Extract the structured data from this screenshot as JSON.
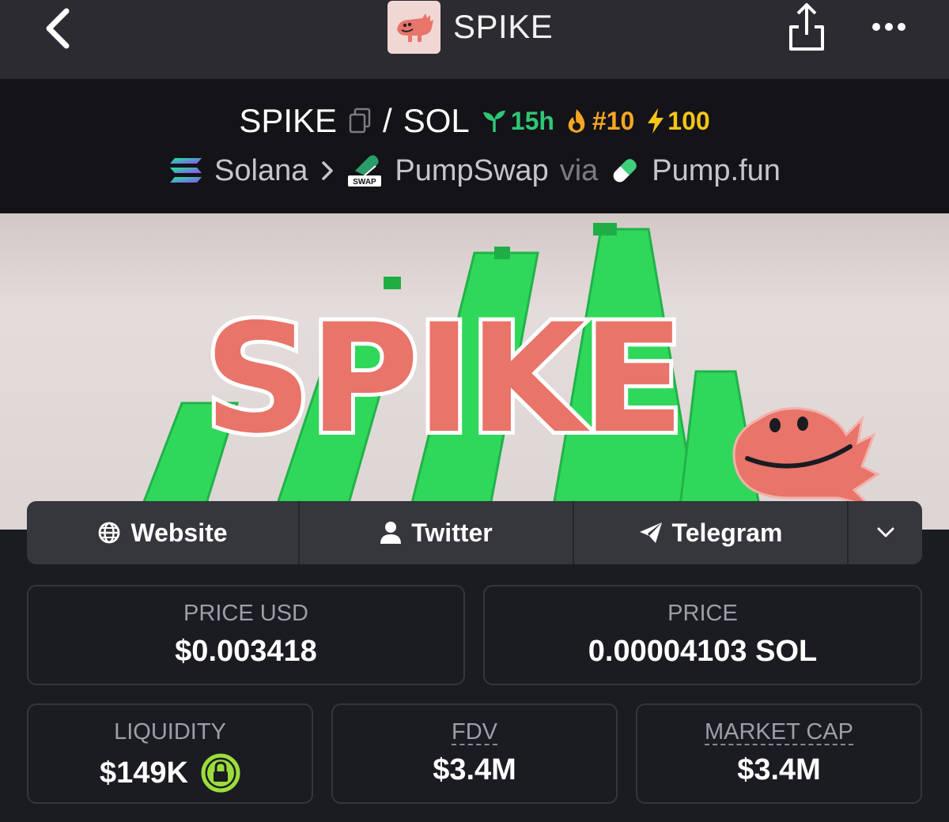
{
  "app": {
    "title": "SPIKE"
  },
  "pair": {
    "base": "SPIKE",
    "separator": "/",
    "quote": "SOL",
    "age": "15h",
    "rank": "#10",
    "boosts": "100"
  },
  "chain_path": {
    "chain": "Solana",
    "dex": "PumpSwap",
    "via_label": "via",
    "launchpad": "Pump.fun",
    "dex_badge": "SWAP"
  },
  "banner": {
    "text": "SPIKE"
  },
  "links": [
    {
      "label": "Website",
      "icon": "globe-icon"
    },
    {
      "label": "Twitter",
      "icon": "user-icon"
    },
    {
      "label": "Telegram",
      "icon": "paper-plane-icon"
    }
  ],
  "stats": {
    "price_usd": {
      "label": "PRICE USD",
      "value": "$0.003418"
    },
    "price": {
      "label": "PRICE",
      "value": "0.00004103 SOL"
    },
    "liquidity": {
      "label": "LIQUIDITY",
      "value": "$149K"
    },
    "fdv": {
      "label": "FDV",
      "value": "$3.4M"
    },
    "market_cap": {
      "label": "MARKET CAP",
      "value": "$3.4M"
    }
  },
  "colors": {
    "background": "#1b1b22",
    "header": "#2b2b31",
    "pair_bar": "#131318",
    "age_green": "#2ec776",
    "rank_orange": "#f5a623",
    "boost_yellow": "#f5c518",
    "banner_red": "#e8746a",
    "banner_green": "#2fd85a",
    "lock_green": "#9bdd3c"
  }
}
